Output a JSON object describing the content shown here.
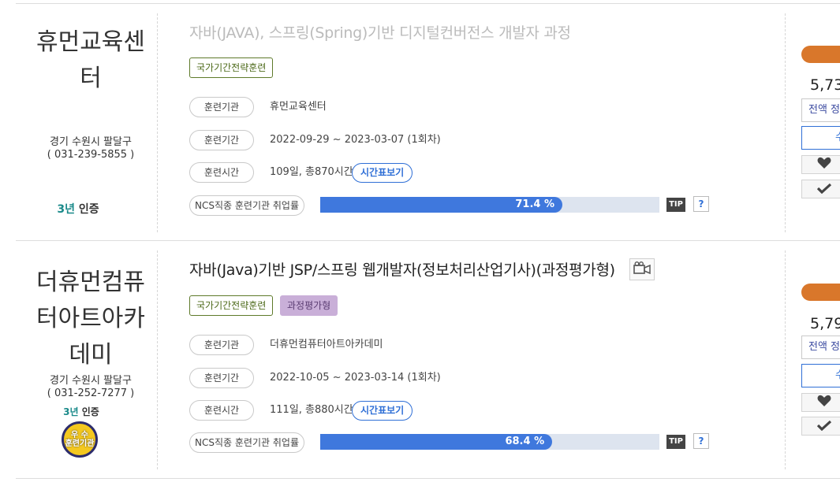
{
  "courses": [
    {
      "title": "자바(JAVA), 스프링(Spring)기반 디지털컨버전스 개발자 과정",
      "org_name": "휴먼교육센터",
      "address": "경기 수원시 팔달구",
      "phone": "( 031-239-5855 )",
      "cert_years": "3년",
      "cert_label": "인증",
      "tags": [
        "국가기간전략훈련"
      ],
      "fields": {
        "org_label": "훈련기관",
        "org_value": "휴먼교육센터",
        "period_label": "훈련기간",
        "period_value": "2022-09-29 ~ 2023-03-07 (1회차)",
        "time_label": "훈련시간",
        "time_value": "109일, 총870시간",
        "time_button": "시간표보기"
      },
      "ncs_label": "NCS직종 훈련기관 취업률",
      "employment_rate": 71.4,
      "employment_rate_text": "71.4 %",
      "tip": "TIP",
      "help": "?",
      "price": "5,73",
      "refund_button": "전액 정",
      "apply_button": "수"
    },
    {
      "title": "자바(Java)기반 JSP/스프링 웹개발자(정보처리산업기사)(과정평가형)",
      "org_name": "더휴먼컴퓨터아트아카데미",
      "address": "경기 수원시 팔달구",
      "phone": "( 031-252-7277 )",
      "cert_years": "3년",
      "cert_label": "인증",
      "excellence_badge_line1": "우 수",
      "excellence_badge_line2": "훈련기관",
      "tags": [
        "국가기간전략훈련",
        "과정평가형"
      ],
      "fields": {
        "org_label": "훈련기관",
        "org_value": "더휴먼컴퓨터아트아카데미",
        "period_label": "훈련기간",
        "period_value": "2022-10-05 ~ 2023-03-14 (1회차)",
        "time_label": "훈련시간",
        "time_value": "111일, 총880시간",
        "time_button": "시간표보기"
      },
      "ncs_label": "NCS직종 훈련기관 취업률",
      "employment_rate": 68.4,
      "employment_rate_text": "68.4 %",
      "tip": "TIP",
      "help": "?",
      "price": "5,79",
      "refund_button": "전액 정",
      "apply_button": "수"
    }
  ],
  "icons": [
    "heart-icon",
    "check-icon",
    "video-camera-icon"
  ],
  "colors": {
    "accent_blue": "#3f78dd",
    "orange": "#d9772b",
    "tag_green": "#5e7a2a",
    "tag_purple": "#c9afd8"
  }
}
